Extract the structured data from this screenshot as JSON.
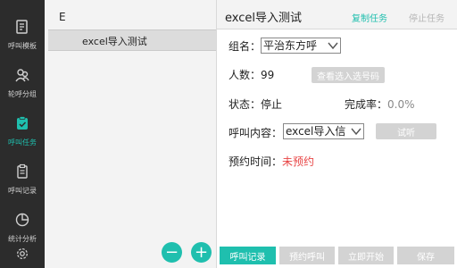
{
  "sidebar": {
    "items": [
      {
        "label": "呼叫模板",
        "icon": "template-icon"
      },
      {
        "label": "轮呼分组",
        "icon": "group-icon"
      },
      {
        "label": "呼叫任务",
        "icon": "task-icon",
        "active": true
      },
      {
        "label": "呼叫记录",
        "icon": "record-icon"
      },
      {
        "label": "统计分析",
        "icon": "pie-chart-icon"
      },
      {
        "label": "",
        "icon": "settings-icon"
      }
    ],
    "active_color": "#1fbfae"
  },
  "list": {
    "group_header": "E",
    "items": [
      {
        "label": "excel导入测试",
        "selected": true
      }
    ],
    "remove_button": "−",
    "add_button": "+"
  },
  "detail": {
    "title": "excel导入测试",
    "copy_task": "复制任务",
    "stop_task": "停止任务",
    "group_label": "组名：",
    "group_value": "平治东方呼",
    "count_label": "人数：",
    "count_value": "99",
    "view_numbers_button": "查看选入选号码",
    "status_label": "状态：",
    "status_value": "停止",
    "completion_label": "完成率：",
    "completion_value": "0.0%",
    "content_label": "呼叫内容：",
    "content_value": "excel导入信",
    "test_call_button": "试听",
    "schedule_label": "预约时间：",
    "schedule_value": "未预约"
  },
  "bottom_bar": {
    "call_record": "呼叫记录",
    "schedule_call": "预约呼叫",
    "start_now": "立即开始",
    "save": "保存"
  },
  "colors": {
    "accent": "#1fbfae",
    "sidebar_bg": "#2c2c2c",
    "warning_text": "#e84545",
    "disabled": "#d3d3d3"
  }
}
